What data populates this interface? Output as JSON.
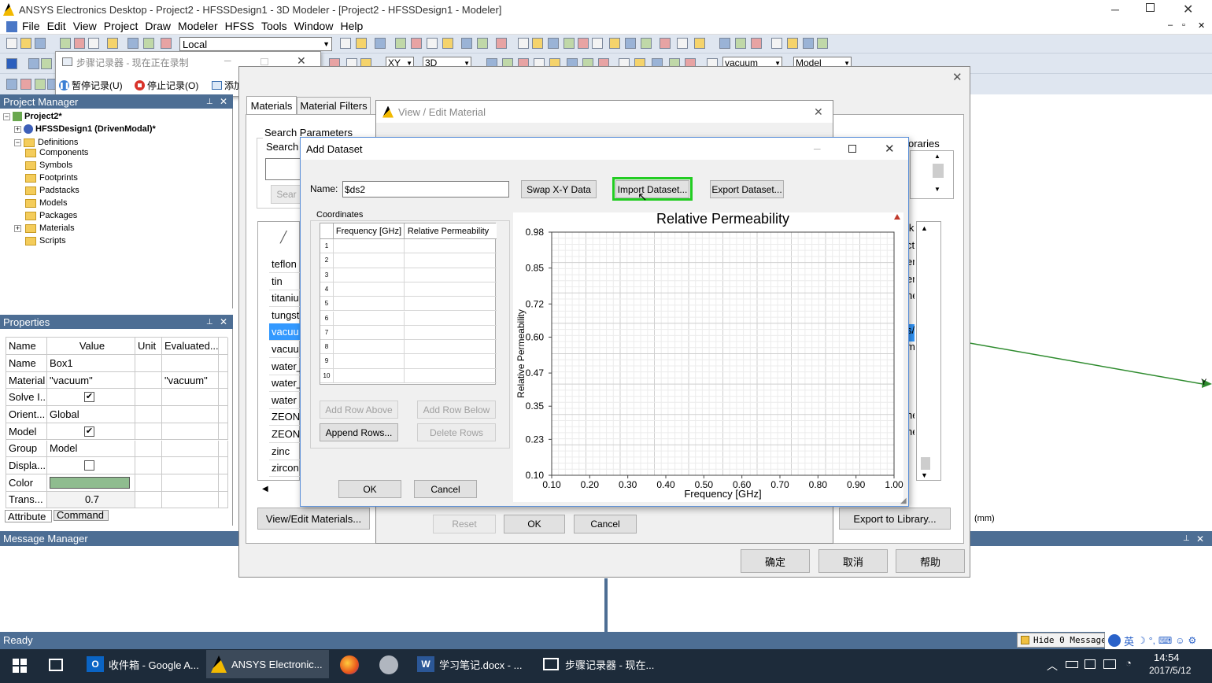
{
  "title_bar": {
    "title": "ANSYS Electronics Desktop - Project2 - HFSSDesign1 - 3D Modeler - [Project2 - HFSSDesign1 - Modeler]"
  },
  "menu": [
    "File",
    "Edit",
    "View",
    "Project",
    "Draw",
    "Modeler",
    "HFSS",
    "Tools",
    "Window",
    "Help"
  ],
  "toolbar": {
    "coord_system": "Local",
    "plane": "XY",
    "mode": "3D",
    "material": "vacuum",
    "model": "Model"
  },
  "recorder": {
    "title": "步骤记录器 - 现在正在录制",
    "pause": "暂停记录(U)",
    "stop": "停止记录(O)",
    "comment": "添加注释(C)"
  },
  "project_manager": {
    "title": "Project Manager",
    "project": "Project2*",
    "design": "HFSSDesign1 (DrivenModal)*",
    "definitions": "Definitions",
    "items": [
      "Components",
      "Symbols",
      "Footprints",
      "Padstacks",
      "Models",
      "Packages",
      "Materials",
      "Scripts"
    ]
  },
  "properties": {
    "title": "Properties",
    "headers": [
      "Name",
      "Value",
      "Unit",
      "Evaluated..."
    ],
    "rows": [
      {
        "name": "Name",
        "value": "Box1",
        "unit": "",
        "eval": ""
      },
      {
        "name": "Material",
        "value": "\"vacuum\"",
        "unit": "",
        "eval": "\"vacuum\""
      },
      {
        "name": "Solve I...",
        "value": "",
        "unit": "",
        "eval": ""
      },
      {
        "name": "Orient...",
        "value": "Global",
        "unit": "",
        "eval": ""
      },
      {
        "name": "Model",
        "value": "",
        "unit": "",
        "eval": ""
      },
      {
        "name": "Group",
        "value": "Model",
        "unit": "",
        "eval": ""
      },
      {
        "name": "Displa...",
        "value": "",
        "unit": "",
        "eval": ""
      },
      {
        "name": "Color",
        "value": "",
        "unit": "",
        "eval": ""
      },
      {
        "name": "Trans...",
        "value": "0.7",
        "unit": "",
        "eval": ""
      }
    ],
    "tabs": [
      "Attribute",
      "Command"
    ],
    "color_swatch": "#8fbc8f"
  },
  "material_dialog": {
    "tabs": [
      "Materials",
      "Material Filters"
    ],
    "search_group": "Search Parameters",
    "search_label": "Search",
    "search_button": "Sear",
    "libraries": "oraries",
    "materials": [
      "teflon",
      "tin",
      "titaniu",
      "tungst",
      "vacuu",
      "vacuu",
      "water_",
      "water_",
      "water",
      "ZEONI",
      "ZEONI",
      "zinc",
      "zircon"
    ],
    "right_col": [
      "lk",
      "ct",
      "er",
      "er",
      "ne",
      "",
      "s/",
      "m",
      "",
      "",
      "",
      "ne",
      "ne"
    ],
    "view_edit_btn": "View/Edit Materials...",
    "export_btn": "Export to Library...",
    "ok": "确定",
    "cancel": "取消",
    "help": "帮助"
  },
  "view_edit": {
    "title": "View / Edit Material",
    "reset": "Reset",
    "ok": "OK",
    "cancel": "Cancel"
  },
  "add_dataset": {
    "title": "Add Dataset",
    "name_label": "Name:",
    "name_value": "$ds2",
    "swap_btn": "Swap X-Y Data",
    "import_btn": "Import Dataset...",
    "export_btn": "Export Dataset...",
    "coord_group": "Coordinates",
    "col_headers": [
      "Frequency [GHz]",
      "Relative Permeability"
    ],
    "row_numbers": [
      "1",
      "2",
      "3",
      "4",
      "5",
      "6",
      "7",
      "8",
      "9",
      "10"
    ],
    "add_above": "Add Row Above",
    "add_below": "Add Row Below",
    "append": "Append Rows...",
    "delete": "Delete Rows",
    "ok": "OK",
    "cancel": "Cancel",
    "highlight_color": "#22cc22"
  },
  "chart_data": {
    "type": "line",
    "title": "Relative Permeability",
    "xlabel": "Frequency [GHz]",
    "ylabel": "Relative Permeability",
    "xlim": [
      0.1,
      1.0
    ],
    "ylim": [
      0.1,
      0.98
    ],
    "xticks": [
      "0.10",
      "0.20",
      "0.30",
      "0.40",
      "0.50",
      "0.60",
      "0.70",
      "0.80",
      "0.90",
      "1.00"
    ],
    "yticks": [
      "0.98",
      "0.85",
      "0.72",
      "0.60",
      "0.47",
      "0.35",
      "0.23",
      "0.10"
    ],
    "grid": true,
    "series": []
  },
  "viewport": {
    "units": "(mm)",
    "axis_label": "Y"
  },
  "message_manager": {
    "title": "Message Manager"
  },
  "status": {
    "text": "Ready",
    "hide_messages": "Hide 0 Messages"
  },
  "taskbar": {
    "items": [
      "收件箱 - Google A...",
      "ANSYS Electronic...",
      "学习笔记.docx - ...",
      "步骤记录器 - 现在..."
    ],
    "ime": "英",
    "time": "14:54",
    "date": "2017/5/12"
  }
}
